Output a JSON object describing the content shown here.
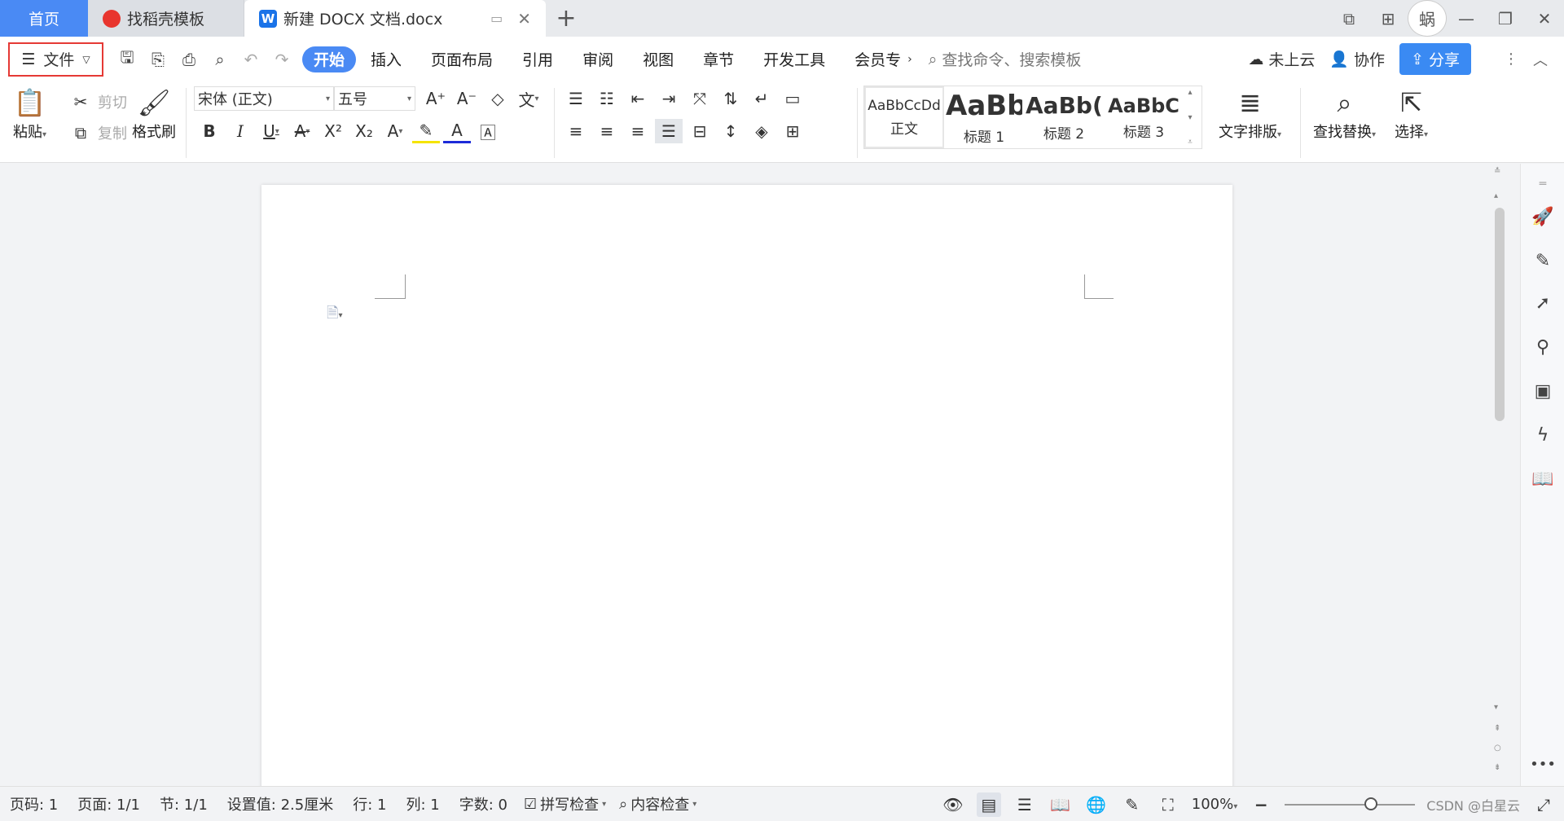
{
  "tabs": {
    "home": "首页",
    "template": "找稻壳模板",
    "document": "新建 DOCX 文档.docx",
    "add": "+"
  },
  "window": {
    "avatar_text": "蜗"
  },
  "menu": {
    "file_label": "文件",
    "tabs": [
      "开始",
      "插入",
      "页面布局",
      "引用",
      "审阅",
      "视图",
      "章节",
      "开发工具",
      "会员专"
    ],
    "search_placeholder": "查找命令、搜索模板",
    "cloud_label": "未上云",
    "collab_label": "协作",
    "share_label": "分享"
  },
  "ribbon": {
    "paste": "粘贴",
    "cut": "剪切",
    "copy": "复制",
    "format_painter": "格式刷",
    "font_name": "宋体 (正文)",
    "font_size": "五号",
    "styles": [
      {
        "sample": "AaBbCcDd",
        "label": "正文"
      },
      {
        "sample": "AaBb",
        "label": "标题 1"
      },
      {
        "sample": "AaBb(",
        "label": "标题 2"
      },
      {
        "sample": "AaBbC",
        "label": "标题 3"
      }
    ],
    "text_layout": "文字排版",
    "find_replace": "查找替换",
    "select": "选择"
  },
  "status": {
    "page_code": "页码: 1",
    "pages": "页面: 1/1",
    "section": "节: 1/1",
    "setting": "设置值: 2.5厘米",
    "row": "行: 1",
    "col": "列: 1",
    "word_count": "字数: 0",
    "spell_check": "拼写检查",
    "content_check": "内容检查",
    "zoom": "100%",
    "watermark": "CSDN @白星云"
  },
  "colors": {
    "accent": "#4a8af4",
    "file_highlight": "#e53935",
    "share": "#3a8af3"
  }
}
